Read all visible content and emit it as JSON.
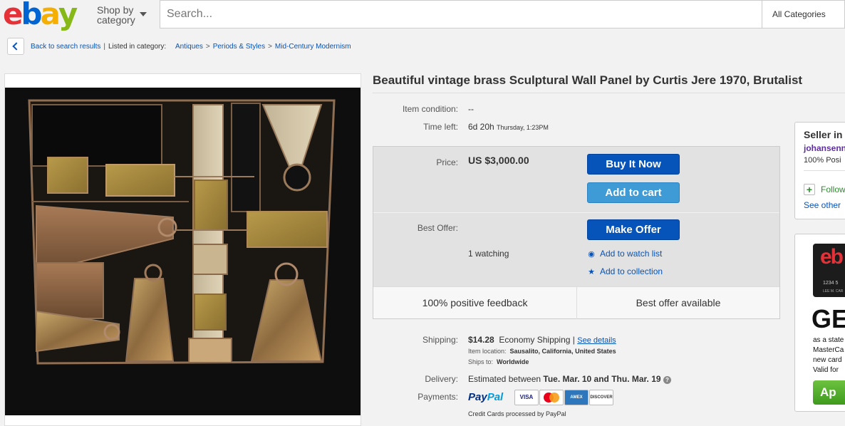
{
  "header": {
    "logo_letters": [
      "e",
      "b",
      "a",
      "y"
    ],
    "shop_by_line1": "Shop by",
    "shop_by_line2": "category",
    "search_placeholder": "Search...",
    "category_select": "All Categories"
  },
  "breadcrumb": {
    "back_label": "Back to search results",
    "listed_label": "Listed in category:",
    "items": [
      "Antiques",
      "Periods & Styles",
      "Mid-Century Modernism"
    ]
  },
  "listing": {
    "title": "Beautiful vintage brass Sculptural Wall Panel by Curtis Jere 1970, Brutalist",
    "condition_label": "Item condition:",
    "condition_value": "--",
    "time_left_label": "Time left:",
    "time_left_value": "6d 20h",
    "time_left_detail": "Thursday, 1:23PM"
  },
  "buy_box": {
    "price_label": "Price:",
    "price_value": "US $3,000.00",
    "buy_now": "Buy It Now",
    "add_to_cart": "Add to cart",
    "best_offer_label": "Best Offer:",
    "make_offer": "Make Offer",
    "watching": "1 watching",
    "add_watch": "Add to watch list",
    "add_collection": "Add to collection",
    "feedback": "100% positive feedback",
    "best_offer_available": "Best offer available"
  },
  "shipping": {
    "label": "Shipping:",
    "price": "$14.28",
    "method": "Economy Shipping",
    "separator": "|",
    "details_link": "See details",
    "location_label": "Item location:",
    "location_value": "Sausalito, California, United States",
    "ships_to_label": "Ships to:",
    "ships_to_value": "Worldwide"
  },
  "delivery": {
    "label": "Delivery:",
    "prefix": "Estimated between",
    "range": "Tue. Mar. 10 and Thu. Mar. 19"
  },
  "payments": {
    "label": "Payments:",
    "paypal_pay": "Pay",
    "paypal_pal": "Pal",
    "cards": [
      "VISA",
      "MC",
      "AMEX",
      "DISCOVER"
    ],
    "note": "Credit Cards processed by PayPal"
  },
  "seller": {
    "heading": "Seller in",
    "name": "johansenn",
    "positive": "100% Posi",
    "follow": "Follow",
    "see_other": "See other"
  },
  "ad": {
    "logo": "eb",
    "card_number": "1234 5",
    "card_name": "LEE M. CAR",
    "headline": "GE",
    "line1": "as a state",
    "line2": "MasterCa",
    "line3": "new card",
    "line4": "Valid for",
    "apply": "Ap"
  },
  "colors": {
    "ebay_red": "#e53238",
    "ebay_blue": "#0064d2",
    "ebay_yellow": "#f5af02",
    "ebay_green": "#86b817",
    "link_blue": "#0654ba"
  }
}
